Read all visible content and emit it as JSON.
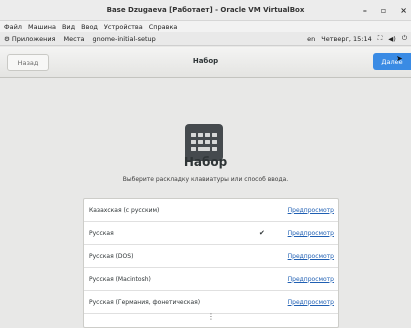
{
  "window": {
    "title": "Base Dzugaeva [Работает] - Oracle VM VirtualBox",
    "minimize": "–",
    "maximize": "▫",
    "close": "×"
  },
  "menu": [
    "Файл",
    "Машина",
    "Вид",
    "Ввод",
    "Устройства",
    "Справка"
  ],
  "topbar": {
    "apps": "Приложения",
    "places": "Места",
    "current": "gnome-initial-setup",
    "lang": "en",
    "datetime": "Четверг, 15:14"
  },
  "header": {
    "back": "Назад",
    "title": "Набор",
    "next": "Далее"
  },
  "main": {
    "heading": "Набор",
    "subtitle": "Выберите раскладку клавиатуры или способ ввода.",
    "preview_label": "Предпросмотр",
    "layouts": [
      {
        "name": "Казахская (с русским)",
        "selected": false
      },
      {
        "name": "Русская",
        "selected": true
      },
      {
        "name": "Русская (DOS)",
        "selected": false
      },
      {
        "name": "Русская (Macintosh)",
        "selected": false
      },
      {
        "name": "Русская (Германия, фонетическая)",
        "selected": false
      }
    ],
    "more": "⋮"
  },
  "colors": {
    "accent": "#3a8be4",
    "link": "#1f5fb3",
    "icon_bg": "#454a4e"
  },
  "icons": [
    "apps-icon",
    "network-icon",
    "volume-icon",
    "power-icon",
    "keyboard-icon",
    "check-icon",
    "more-icon"
  ]
}
